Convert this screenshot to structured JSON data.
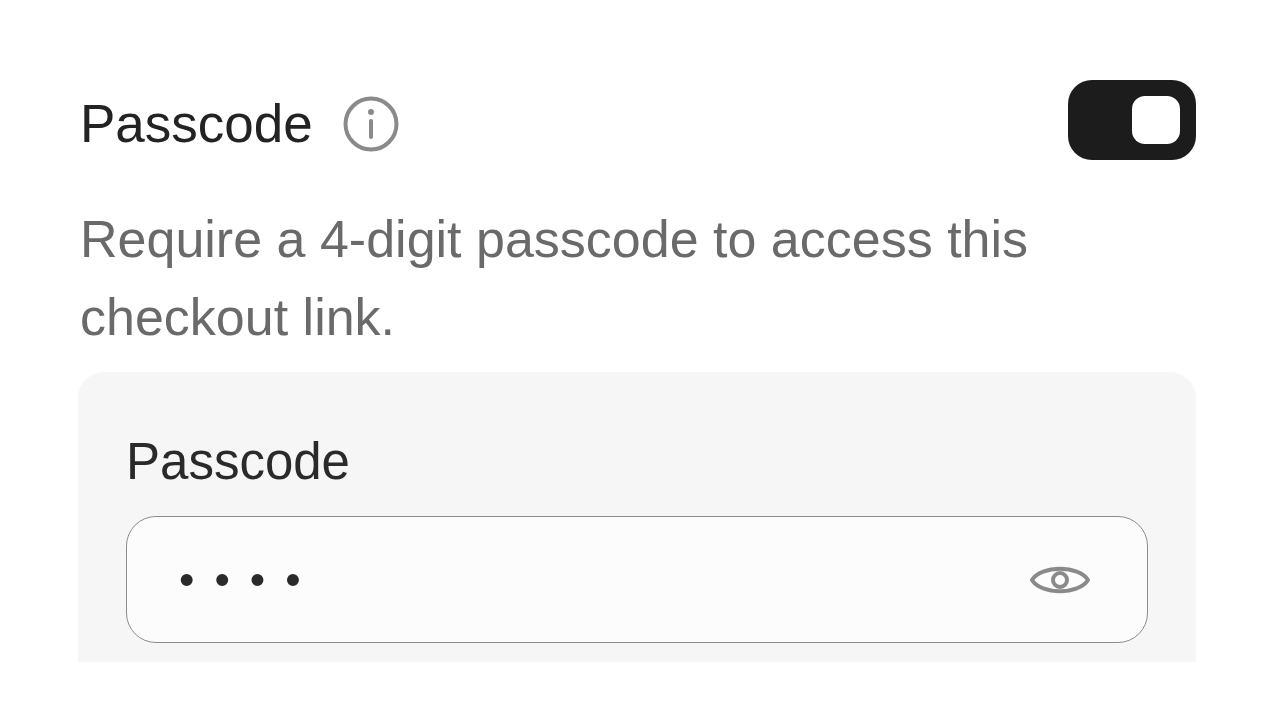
{
  "setting": {
    "title": "Passcode",
    "on": true,
    "description": "Require a 4-digit passcode to access this checkout link."
  },
  "passcode_field": {
    "label": "Passcode",
    "value": "••••"
  }
}
